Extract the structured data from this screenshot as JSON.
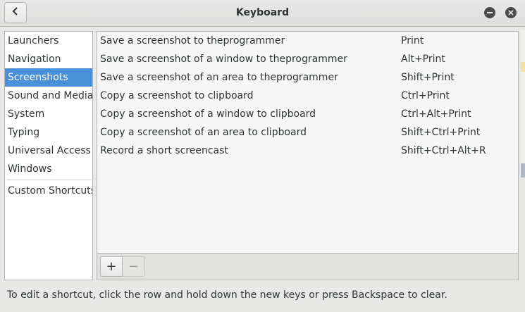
{
  "window": {
    "title": "Keyboard"
  },
  "sidebar": {
    "items": [
      {
        "label": "Launchers"
      },
      {
        "label": "Navigation"
      },
      {
        "label": "Screenshots",
        "selected": true
      },
      {
        "label": "Sound and Media"
      },
      {
        "label": "System"
      },
      {
        "label": "Typing"
      },
      {
        "label": "Universal Access"
      },
      {
        "label": "Windows"
      }
    ],
    "custom": "Custom Shortcuts"
  },
  "shortcuts": [
    {
      "action": "Save a screenshot to theprogrammer",
      "accel": "Print"
    },
    {
      "action": "Save a screenshot of a window to theprogrammer",
      "accel": "Alt+Print"
    },
    {
      "action": "Save a screenshot of an area to theprogrammer",
      "accel": "Shift+Print"
    },
    {
      "action": "Copy a screenshot to clipboard",
      "accel": "Ctrl+Print"
    },
    {
      "action": "Copy a screenshot of a window to clipboard",
      "accel": "Ctrl+Alt+Print"
    },
    {
      "action": "Copy a screenshot of an area to clipboard",
      "accel": "Shift+Ctrl+Print"
    },
    {
      "action": "Record a short screencast",
      "accel": "Shift+Ctrl+Alt+R"
    }
  ],
  "toolbar": {
    "add_label": "+",
    "remove_label": "−"
  },
  "hint": "To edit a shortcut, click the row and hold down the new keys or press Backspace to clear.",
  "colors": {
    "accent": "#4a90d9",
    "window_bg": "#e8e8e7"
  },
  "icons": {
    "back": "chevron-left-icon",
    "minimize": "minimize-icon",
    "close": "close-icon"
  }
}
